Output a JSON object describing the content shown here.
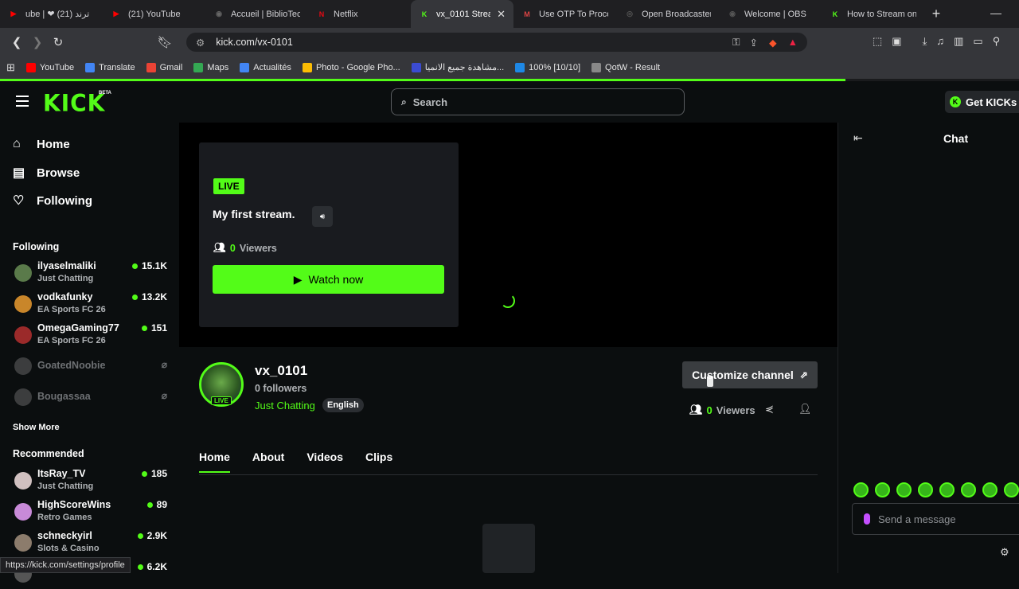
{
  "browser": {
    "tabs": [
      {
        "label": "ube | ❤ ترند (21)",
        "fav": "▶",
        "favcolor": "#ff0000"
      },
      {
        "label": "(21) YouTube",
        "fav": "▶",
        "favcolor": "#ff0000"
      },
      {
        "label": "Accueil | BiblioTec",
        "fav": "◉",
        "favcolor": "#666"
      },
      {
        "label": "Netflix",
        "fav": "N",
        "favcolor": "#e50914"
      },
      {
        "label": "vx_0101 Strea",
        "fav": "K",
        "favcolor": "#53fc18",
        "active": true
      },
      {
        "label": "Use OTP To Procee",
        "fav": "M",
        "favcolor": "#d44"
      },
      {
        "label": "Open Broadcaster",
        "fav": "◎",
        "favcolor": "#555"
      },
      {
        "label": "Welcome | OBS",
        "fav": "◉",
        "favcolor": "#555"
      },
      {
        "label": "How to Stream on",
        "fav": "K",
        "favcolor": "#53fc18"
      }
    ],
    "url": "kick.com/vx-0101",
    "bookmarks": [
      {
        "label": "YouTube",
        "color": "#ff0000"
      },
      {
        "label": "Translate",
        "color": "#4285f4"
      },
      {
        "label": "Gmail",
        "color": "#ea4335"
      },
      {
        "label": "Maps",
        "color": "#34a853"
      },
      {
        "label": "Actualités",
        "color": "#4285f4"
      },
      {
        "label": "Photo - Google Pho...",
        "color": "#fbbc04"
      },
      {
        "label": "مشاهدة جميع الانميا...",
        "color": "#3b4bd1"
      },
      {
        "label": "100% [10/10]",
        "color": "#1e88e5"
      },
      {
        "label": "QotW - Result",
        "color": "#888"
      }
    ],
    "status_url": "https://kick.com/settings/profile"
  },
  "header": {
    "logo": "KICK",
    "beta": "BETA",
    "search_placeholder": "Search",
    "get_kicks": "Get KICKs"
  },
  "sidebar": {
    "nav": [
      {
        "label": "Home",
        "icon": "home-icon"
      },
      {
        "label": "Browse",
        "icon": "browse-icon"
      },
      {
        "label": "Following",
        "icon": "heart-icon"
      }
    ],
    "following_title": "Following",
    "following": [
      {
        "name": "ilyaselmaliki",
        "category": "Just Chatting",
        "viewers": "15.1K",
        "color": "#5a7a4a"
      },
      {
        "name": "vodkafunky",
        "category": "EA Sports FC 26",
        "viewers": "13.2K",
        "color": "#c9862a"
      },
      {
        "name": "OmegaGaming77",
        "category": "EA Sports FC 26",
        "viewers": "151",
        "color": "#9b2a2a"
      },
      {
        "name": "GoatedNoobie",
        "offline": true,
        "color": "#777"
      },
      {
        "name": "Bougassaa",
        "offline": true,
        "color": "#777"
      }
    ],
    "show_more": "Show More",
    "recommended_title": "Recommended",
    "recommended": [
      {
        "name": "ItsRay_TV",
        "category": "Just Chatting",
        "viewers": "185",
        "color": "#d0c0c0"
      },
      {
        "name": "HighScoreWins",
        "category": "Retro Games",
        "viewers": "89",
        "color": "#c88ad8"
      },
      {
        "name": "schneckyirl",
        "category": "Slots & Casino",
        "viewers": "2.9K",
        "color": "#8c7c6c"
      },
      {
        "name": "",
        "category": "",
        "viewers": "6.2K",
        "color": "#555"
      }
    ]
  },
  "player": {
    "live": "LIVE",
    "title": "My first stream.",
    "viewers_count": "0",
    "viewers_label": "Viewers",
    "watch_now": "Watch now"
  },
  "channel": {
    "name": "vx_0101",
    "followers": "0 followers",
    "category": "Just Chatting",
    "tag": "English",
    "live": "LIVE",
    "customize": "Customize channel",
    "viewers_count": "0",
    "viewers_label": "Viewers",
    "tabs": [
      "Home",
      "About",
      "Videos",
      "Clips"
    ]
  },
  "chat": {
    "title": "Chat",
    "placeholder": "Send a message"
  }
}
